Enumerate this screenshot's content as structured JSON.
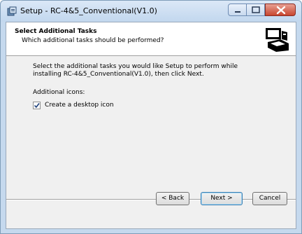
{
  "window": {
    "title": "Setup - RC-4&5_Conventional(V1.0)"
  },
  "header": {
    "title": "Select Additional Tasks",
    "subtitle": "Which additional tasks should be performed?",
    "logo_icon": "computer-box-icon"
  },
  "content": {
    "description": "Select the additional tasks you would like Setup to perform while installing RC-4&5_Conventional(V1.0), then click Next.",
    "additional_icons_label": "Additional icons:",
    "desktop_icon_checkbox": {
      "label": "Create a desktop icon",
      "checked": true
    }
  },
  "buttons": {
    "back": "< Back",
    "next": "Next >",
    "cancel": "Cancel"
  }
}
